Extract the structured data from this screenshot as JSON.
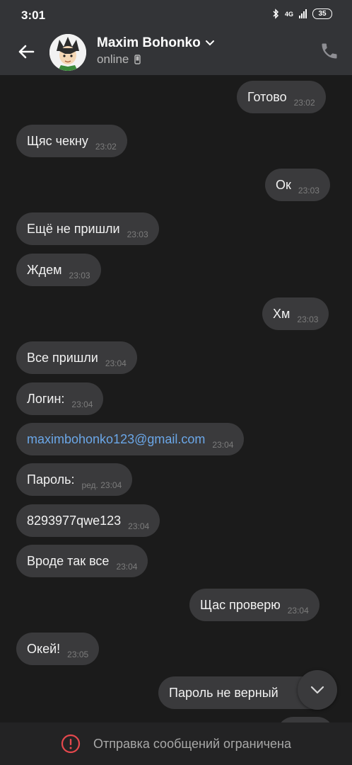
{
  "status_bar": {
    "time": "3:01",
    "network": "4G",
    "battery": "35"
  },
  "header": {
    "contact_name": "Maxim Bohonko",
    "status": "online"
  },
  "messages": [
    {
      "text": "Готово",
      "time": "23:02",
      "side": "out"
    },
    {
      "text": "Щяс чекну",
      "time": "23:02",
      "side": "in"
    },
    {
      "text": "Ок",
      "time": "23:03",
      "side": "out"
    },
    {
      "text": "Ещё не пришли",
      "time": "23:03",
      "side": "in"
    },
    {
      "text": "Ждем",
      "time": "23:03",
      "side": "in"
    },
    {
      "text": "Хм",
      "time": "23:03",
      "side": "out"
    },
    {
      "text": "Все пришли",
      "time": "23:04",
      "side": "in"
    },
    {
      "text": "Логин:",
      "time": "23:04",
      "side": "in"
    },
    {
      "text": "maximbohonko123@gmail.com",
      "time": "23:04",
      "side": "in",
      "link": true
    },
    {
      "text": "Пароль:",
      "time": "ред. 23:04",
      "side": "in"
    },
    {
      "text": "8293977qwe123",
      "time": "23:04",
      "side": "in"
    },
    {
      "text": "Вроде так все",
      "time": "23:04",
      "side": "in"
    },
    {
      "text": "Щас проверю",
      "time": "23:04",
      "side": "out"
    },
    {
      "text": "Окей!",
      "time": "23:05",
      "side": "in"
    },
    {
      "text": "Пароль не верный",
      "time": "",
      "side": "out"
    }
  ],
  "footer": {
    "text": "Отправка сообщений ограничена"
  },
  "icons": {
    "back": "arrow-left-icon",
    "call": "phone-icon",
    "scroll": "chevron-down-icon",
    "warning": "alert-circle-icon"
  },
  "colors": {
    "bubble": "#3a3a3c",
    "link": "#6ba7e8",
    "warning": "#e5484d",
    "header": "#333437"
  }
}
